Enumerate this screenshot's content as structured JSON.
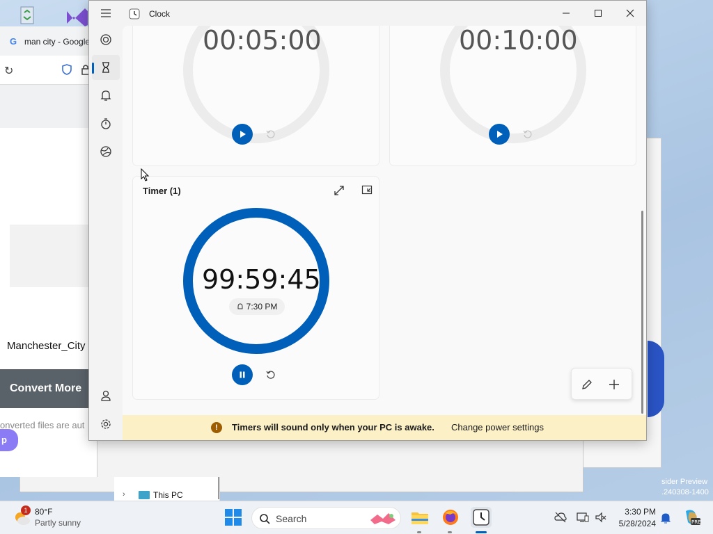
{
  "browser": {
    "tab_title": "man city - Google",
    "page_label": "Manchester_City",
    "convert_label": "Convert More",
    "convert_note": "onverted files are aut",
    "side_button": "p"
  },
  "explorer": {
    "nav_item": "This PC"
  },
  "watermark": {
    "line1": "sider Preview",
    "line2": ".240308-1400"
  },
  "clock_app": {
    "title": "Clock",
    "nav": [
      "Focus sessions",
      "Timer",
      "Alarm",
      "Stopwatch",
      "World clock"
    ],
    "selected_nav": "Timer",
    "timers": [
      {
        "time": "00:05:00",
        "state": "stopped"
      },
      {
        "time": "00:10:00",
        "state": "stopped"
      },
      {
        "title": "Timer (1)",
        "time": "99:59:45",
        "alarm": "7:30 PM",
        "state": "running"
      }
    ],
    "banner_message": "Timers will sound only when your PC is awake.",
    "banner_link": "Change power settings"
  },
  "taskbar": {
    "weather_temp": "80°F",
    "weather_desc": "Partly sunny",
    "weather_badge": "1",
    "search_placeholder": "Search",
    "time": "3:30 PM",
    "date": "5/28/2024"
  },
  "colors": {
    "accent": "#005fb8",
    "banner": "#fcf0c7"
  }
}
